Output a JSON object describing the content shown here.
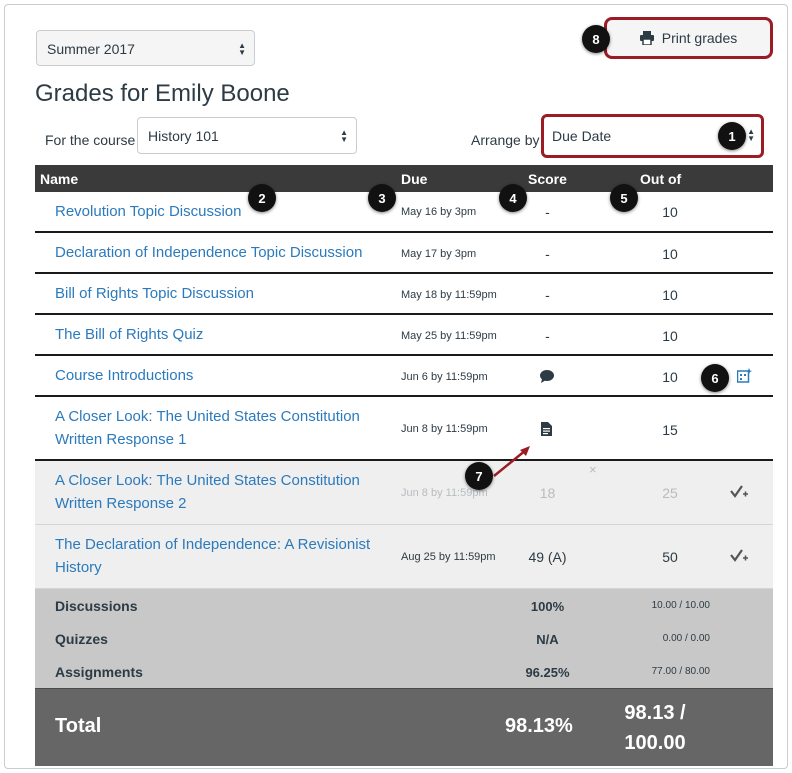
{
  "term_select": {
    "value": "Summer 2017"
  },
  "print_button": {
    "label": "Print grades"
  },
  "page_title": "Grades for Emily Boone",
  "course": {
    "label": "For the course",
    "value": "History 101"
  },
  "arrange": {
    "label": "Arrange by",
    "value": "Due Date"
  },
  "table": {
    "headers": {
      "name": "Name",
      "due": "Due",
      "score": "Score",
      "out_of": "Out of"
    },
    "rows": [
      {
        "name": "Revolution Topic Discussion",
        "due": "May 16 by 3pm",
        "score": "-",
        "out_of": "10"
      },
      {
        "name": "Declaration of Independence Topic Discussion",
        "due": "May 17 by 3pm",
        "score": "-",
        "out_of": "10"
      },
      {
        "name": "Bill of Rights Topic Discussion",
        "due": "May 18 by 11:59pm",
        "score": "-",
        "out_of": "10"
      },
      {
        "name": "The Bill of Rights Quiz",
        "due": "May 25 by 11:59pm",
        "score": "-",
        "out_of": "10"
      },
      {
        "name": "Course Introductions",
        "due": "Jun 6 by 11:59pm",
        "score": "",
        "out_of": "10"
      },
      {
        "name": "A Closer Look: The United States Constitution Written Response 1",
        "due": "Jun 8 by 11:59pm",
        "score": "",
        "out_of": "15"
      },
      {
        "name": "A Closer Look: The United States Constitution Written Response 2",
        "due": "Jun 8 by 11:59pm",
        "score": "18",
        "out_of": "25"
      },
      {
        "name": "The Declaration of Independence: A Revisionist History",
        "due": "Aug 25 by 11:59pm",
        "score": "49 (A)",
        "out_of": "50"
      }
    ]
  },
  "summary": [
    {
      "name": "Discussions",
      "percent": "100%",
      "fraction": "10.00 / 10.00"
    },
    {
      "name": "Quizzes",
      "percent": "N/A",
      "fraction": "0.00 / 0.00"
    },
    {
      "name": "Assignments",
      "percent": "96.25%",
      "fraction": "77.00 / 80.00"
    }
  ],
  "total": {
    "label": "Total",
    "percent": "98.13%",
    "fraction_top": "98.13 /",
    "fraction_bottom": "100.00"
  },
  "dismiss_glyph": "×",
  "badges": [
    "1",
    "2",
    "3",
    "4",
    "5",
    "6",
    "7",
    "8"
  ],
  "colors": {
    "link": "#2b7abc",
    "highlight": "#9b1c24",
    "header": "#3a3a3a",
    "total": "#666666",
    "summary": "#c8c8c8"
  }
}
